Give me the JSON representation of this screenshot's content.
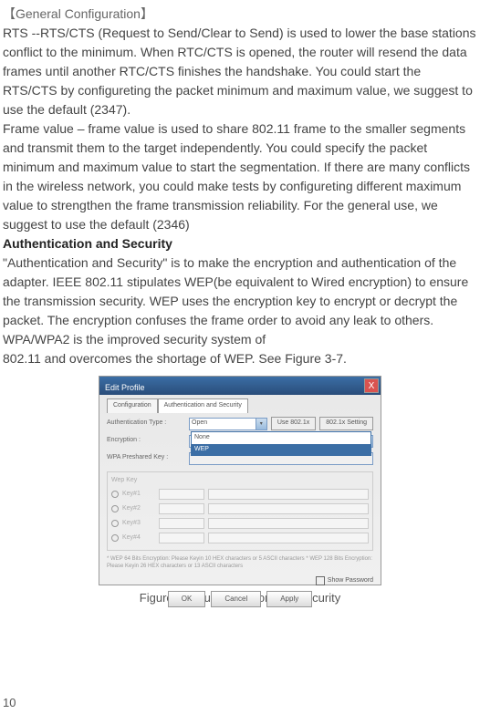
{
  "headings": {
    "bracket": "【General Configuration】",
    "auth_security": "Authentication and Security"
  },
  "paragraphs": {
    "rts": "RTS --RTS/CTS (Request to Send/Clear to Send) is used to lower the base stations conflict to the minimum. When RTC/CTS is opened, the router will resend the data frames until another RTC/CTS finishes the handshake. You could start the RTS/CTS by configureting the packet minimum and maximum value, we suggest to use the default (2347).",
    "frame": "Frame value – frame value is used to share 802.11 frame to the smaller segments and transmit them to the target independently. You could specify the packet minimum and maximum value to start the segmentation. If there are many conflicts in the wireless network, you could make tests by configureting different maximum value to strengthen the frame transmission reliability. For the general use, we suggest to use the default (2346)",
    "auth_desc": "\"Authentication and Security\" is to make the encryption and authentication of the adapter. IEEE 802.11 stipulates WEP(be equivalent to Wired encryption) to ensure the transmission security. WEP uses the encryption key to encrypt or decrypt the packet. The encryption confuses the frame order to avoid any leak to others. WPA/WPA2 is the improved security system of",
    "auth_desc2": "802.11 and overcomes the shortage of WEP. See Figure 3-7."
  },
  "dialog": {
    "title": "Edit Profile",
    "close": "X",
    "tabs": {
      "config": "Configuration",
      "auth": "Authentication and Security"
    },
    "labels": {
      "auth_type": "Authentication Type :",
      "encryption": "Encryption :",
      "wpa_key": "WPA Preshared Key :",
      "wep_key": "Wep Key"
    },
    "auth_value": "Open",
    "use_8021x": "Use 802.1x",
    "setting": "802.1x Setting",
    "enc_value": "None",
    "dropdown_options": {
      "none": "None",
      "wep": "WEP"
    },
    "keys": {
      "k1": "Key#1",
      "k2": "Key#2",
      "k3": "Key#3",
      "k4": "Key#4"
    },
    "note": "* WEP 64 Bits Encryption: Please Keyin 10 HEX characters or 5 ASCII characters\n* WEP 128 Bits Encryption: Please Keyin 26 HEX characters or 13 ASCII characters",
    "show_password": "Show Password",
    "buttons": {
      "ok": "OK",
      "cancel": "Cancel",
      "apply": "Apply"
    }
  },
  "caption": "Figure 3-7 Authentication and Security",
  "page_number": "10"
}
